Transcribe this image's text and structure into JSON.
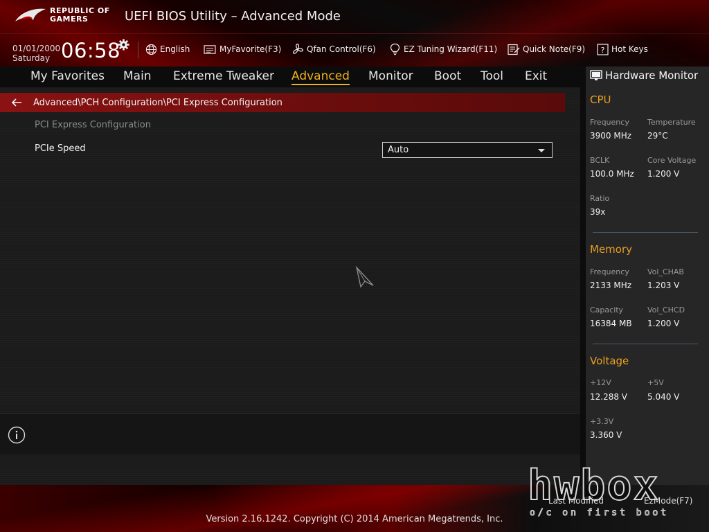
{
  "header": {
    "brand_line1": "REPUBLIC OF",
    "brand_line2": "GAMERS",
    "title": "UEFI BIOS Utility – Advanced Mode",
    "date": "01/01/2000",
    "day": "Saturday",
    "time": "06:58"
  },
  "toolbar": {
    "language": "English",
    "my_favorite": "MyFavorite(F3)",
    "qfan": "Qfan Control(F6)",
    "ez_tuning": "EZ Tuning Wizard(F11)",
    "quick_note": "Quick Note(F9)",
    "hot_keys": "Hot Keys"
  },
  "nav": {
    "tabs": [
      {
        "label": "My Favorites"
      },
      {
        "label": "Main"
      },
      {
        "label": "Extreme Tweaker"
      },
      {
        "label": "Advanced"
      },
      {
        "label": "Monitor"
      },
      {
        "label": "Boot"
      },
      {
        "label": "Tool"
      },
      {
        "label": "Exit"
      }
    ],
    "active": "Advanced"
  },
  "main": {
    "breadcrumb": "Advanced\\PCH Configuration\\PCI Express Configuration",
    "section_title": "PCI Express Configuration",
    "settings": [
      {
        "label": "PCIe Speed",
        "value": "Auto"
      }
    ]
  },
  "hardware_monitor": {
    "title": "Hardware Monitor",
    "cpu": {
      "heading": "CPU",
      "frequency_label": "Frequency",
      "frequency": "3900 MHz",
      "temperature_label": "Temperature",
      "temperature": "29°C",
      "bclk_label": "BCLK",
      "bclk": "100.0 MHz",
      "core_voltage_label": "Core Voltage",
      "core_voltage": "1.200 V",
      "ratio_label": "Ratio",
      "ratio": "39x"
    },
    "memory": {
      "heading": "Memory",
      "frequency_label": "Frequency",
      "frequency": "2133 MHz",
      "vol_chab_label": "Vol_CHAB",
      "vol_chab": "1.203 V",
      "capacity_label": "Capacity",
      "capacity": "16384 MB",
      "vol_chcd_label": "Vol_CHCD",
      "vol_chcd": "1.200 V"
    },
    "voltage": {
      "heading": "Voltage",
      "v12_label": "+12V",
      "v12": "12.288 V",
      "v5_label": "+5V",
      "v5": "5.040 V",
      "v33_label": "+3.3V",
      "v33": "3.360 V"
    }
  },
  "footer": {
    "last_modified": "Last Modified",
    "ez_mode": "EzMode(F7)",
    "copyright": "Version 2.16.1242. Copyright (C) 2014 American Megatrends, Inc."
  },
  "watermark": {
    "word": "hwbox",
    "tagline": "o/c on first boot"
  },
  "colors": {
    "accent": "#f0b020",
    "section_heading": "#e8a020",
    "breadcrumb_bg": "#8a1212"
  }
}
